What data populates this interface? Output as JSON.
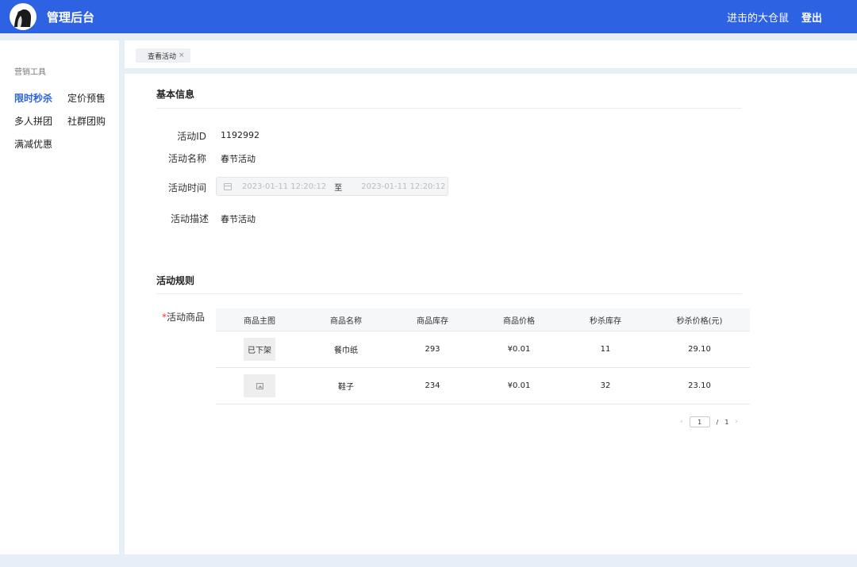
{
  "header": {
    "brand": "管理后台",
    "username": "进击的大仓鼠",
    "logout": "登出",
    "logo_icon": "hamster-avatar-icon"
  },
  "sidebar": {
    "group_label": "营销工具",
    "items": [
      {
        "label": "限时秒杀",
        "active": true
      },
      {
        "label": "定价预售",
        "active": false
      },
      {
        "label": "多人拼团",
        "active": false
      },
      {
        "label": "社群团购",
        "active": false
      },
      {
        "label": "满减优惠",
        "active": false
      }
    ]
  },
  "tabs": [
    {
      "label": "查看活动",
      "close": "×"
    }
  ],
  "basic_info": {
    "title": "基本信息",
    "fields": [
      {
        "label": "活动ID",
        "value": "1192992"
      },
      {
        "label": "活动名称",
        "value": "春节活动"
      },
      {
        "label": "活动时间",
        "start": "2023-01-11 12:20:12",
        "separator": "至",
        "end": "2023-01-11 12:20:12"
      },
      {
        "label": "活动描述",
        "value": "春节活动"
      }
    ]
  },
  "rules": {
    "title": "活动规则",
    "required_mark": "*",
    "products_label": "活动商品",
    "columns": [
      "商品主图",
      "商品名称",
      "商品库存",
      "商品价格",
      "秒杀库存",
      "秒杀价格(元)"
    ],
    "rows": [
      {
        "image_text": "已下架",
        "name": "餐巾纸",
        "stock": "293",
        "price": "¥0.01",
        "seckill_stock": "11",
        "seckill_price": "29.10"
      },
      {
        "image_text": "",
        "name": "鞋子",
        "stock": "234",
        "price": "¥0.01",
        "seckill_stock": "32",
        "seckill_price": "23.10"
      }
    ]
  },
  "pagination": {
    "prev": "‹",
    "current": "1",
    "divider": "/",
    "total": "1",
    "next": "›"
  },
  "colors": {
    "primary": "#2d63e3",
    "background": "#e8eef8",
    "required": "#e03b3b"
  }
}
